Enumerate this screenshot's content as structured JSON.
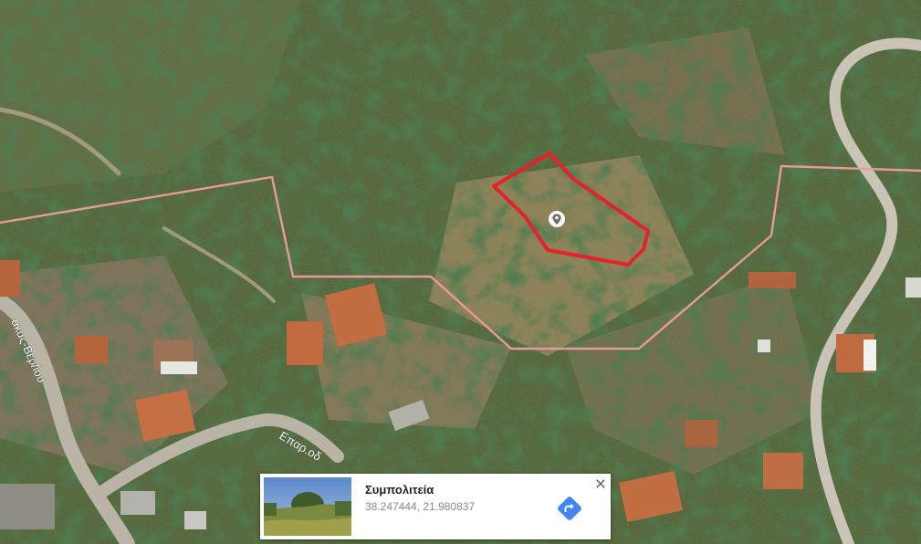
{
  "map": {
    "view": "satellite",
    "road_labels": {
      "left_vertical": "ακας-Βερ/ιου",
      "bottom_road": "Επαρ.οδ"
    },
    "parcel": {
      "outline_color": "#e8202a",
      "marker_icon": "location-pin-icon"
    },
    "boundary_color": "#e79a9a"
  },
  "info_card": {
    "place_name": "Συμπολιτεία",
    "coordinates": "38.247444, 21.980837",
    "directions_icon": "directions-icon",
    "directions_color": "#4285f4",
    "close_glyph": "×"
  }
}
